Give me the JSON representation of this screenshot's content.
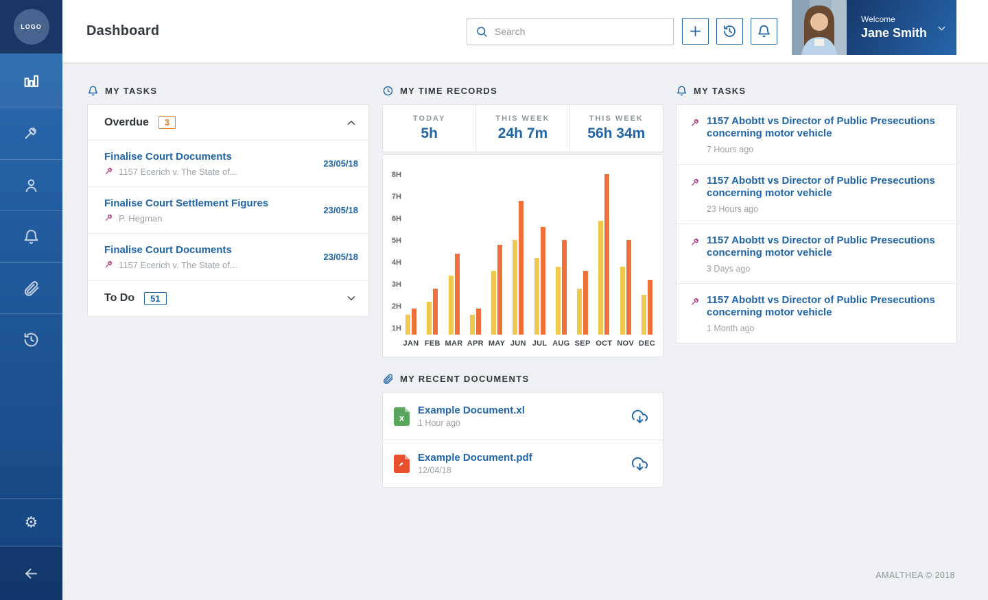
{
  "sidebar": {
    "logo_text": "LOGO",
    "items": [
      {
        "icon": "bar-chart",
        "active": true
      },
      {
        "icon": "gavel"
      },
      {
        "icon": "user"
      },
      {
        "icon": "bell"
      },
      {
        "icon": "paperclip"
      },
      {
        "icon": "history"
      }
    ],
    "bottom_items": [
      {
        "icon": "settings"
      },
      {
        "icon": "back-arrow"
      }
    ]
  },
  "header": {
    "title": "Dashboard",
    "search_placeholder": "Search",
    "welcome_label": "Welcome",
    "user_name": "Jane Smith"
  },
  "my_tasks_left": {
    "section_title": "MY TASKS",
    "group": {
      "label": "Overdue",
      "count": "3"
    },
    "items": [
      {
        "title": "Finalise Court Documents",
        "case": "1157 Ecerich v. The State of...",
        "date": "23/05/18"
      },
      {
        "title": "Finalise Court Settlement Figures",
        "case": "P. Hegman",
        "date": "23/05/18"
      },
      {
        "title": "Finalise Court Documents",
        "case": "1157 Ecerich v. The State of...",
        "date": "23/05/18"
      }
    ],
    "todo": {
      "label": "To Do",
      "count": "51"
    }
  },
  "time_records": {
    "section_title": "MY TIME RECORDS",
    "stats": [
      {
        "label": "TODAY",
        "value": "5h"
      },
      {
        "label": "THIS WEEK",
        "value": "24h 7m"
      },
      {
        "label": "THIS WEEK",
        "value": "56h 34m"
      }
    ]
  },
  "chart_data": {
    "type": "bar",
    "title": "",
    "xlabel": "",
    "ylabel": "hours",
    "categories": [
      "JAN",
      "FEB",
      "MAR",
      "APR",
      "MAY",
      "JUN",
      "JUL",
      "AUG",
      "SEP",
      "OCT",
      "NOV",
      "DEC"
    ],
    "series": [
      {
        "name": "series-yellow",
        "color": "#EFC94F",
        "values": [
          1.6,
          2.2,
          3.4,
          1.6,
          3.6,
          5.0,
          4.2,
          3.8,
          2.8,
          5.9,
          3.8,
          2.5
        ]
      },
      {
        "name": "series-orange",
        "color": "#F0703A",
        "values": [
          1.9,
          2.8,
          4.4,
          1.9,
          4.8,
          6.8,
          5.6,
          5.0,
          3.6,
          8.0,
          5.0,
          3.2
        ]
      }
    ],
    "yticks": [
      "1H",
      "2H",
      "3H",
      "4H",
      "5H",
      "6H",
      "7H",
      "8H"
    ],
    "ylim": [
      0.7,
      8.2
    ],
    "grid": false,
    "legend": false
  },
  "recent_documents": {
    "section_title": "MY RECENT DOCUMENTS",
    "items": [
      {
        "name": "Example Document.xl",
        "meta": "1 Hour ago",
        "type": "xl",
        "type_letter": "x"
      },
      {
        "name": "Example Document.pdf",
        "meta": "12/04/18",
        "type": "pdf"
      }
    ]
  },
  "my_tasks_right": {
    "section_title": "MY TASKS",
    "items": [
      {
        "title": "1157 Abobtt vs Director of Public Presecutions concerning  motor vehicle",
        "time": "7 Hours ago"
      },
      {
        "title": "1157 Abobtt vs Director of Public Presecutions concerning  motor vehicle",
        "time": "23 Hours ago"
      },
      {
        "title": "1157 Abobtt vs Director of Public Presecutions concerning  motor vehicle",
        "time": "3 Days ago"
      },
      {
        "title": "1157 Abobtt vs Director of Public Presecutions concerning  motor vehicle",
        "time": "1 Month ago"
      }
    ]
  },
  "footer": {
    "text": "AMALTHEA © 2018"
  },
  "colors": {
    "accent_blue": "#2065A8",
    "badge_orange": "#E87A22",
    "bar_yellow": "#EFC94F",
    "bar_orange": "#F0703A",
    "gavel_pink": "#A93A7E",
    "sidebar_navy": "#1B3566",
    "content_bg": "#EFF1F4"
  }
}
